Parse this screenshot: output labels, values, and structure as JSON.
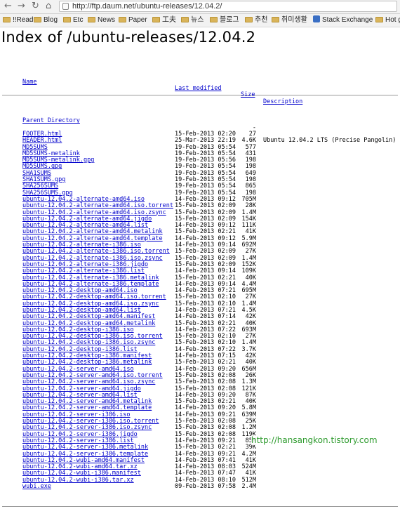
{
  "browser": {
    "back_glyph": "←",
    "forward_glyph": "→",
    "reload_glyph": "↻",
    "home_glyph": "⌂",
    "url": "http://ftp.daum.net/ubuntu-releases/12.04.2/",
    "bookmarks": [
      "!!Read",
      "Blog",
      "Etc",
      "News",
      "Paper",
      "工夫",
      "뉴스",
      "블로그",
      "추천",
      "취미생활",
      "Stack Exchange",
      "Hot gir"
    ]
  },
  "page": {
    "title": "Index of /ubuntu-releases/12.04.2",
    "headers": {
      "name": "Name",
      "modified": "Last modified",
      "size": "Size",
      "description": "Description"
    },
    "parent": {
      "name": "Parent Directory",
      "size": "-"
    },
    "files": [
      {
        "name": "FOOTER.html",
        "date": "15-Feb-2013 02:20",
        "size": "27",
        "desc": ""
      },
      {
        "name": "HEADER.html",
        "date": "25-Mar-2013 22:19",
        "size": "4.6K",
        "desc": "Ubuntu 12.04.2 LTS (Precise Pangolin)"
      },
      {
        "name": "MD5SUMS",
        "date": "19-Feb-2013 05:54",
        "size": "577",
        "desc": ""
      },
      {
        "name": "MD5SUMS-metalink",
        "date": "19-Feb-2013 05:54",
        "size": "431",
        "desc": ""
      },
      {
        "name": "MD5SUMS-metalink.gpg",
        "date": "19-Feb-2013 05:56",
        "size": "198",
        "desc": ""
      },
      {
        "name": "MD5SUMS.gpg",
        "date": "19-Feb-2013 05:54",
        "size": "198",
        "desc": ""
      },
      {
        "name": "SHA1SUMS",
        "date": "19-Feb-2013 05:54",
        "size": "649",
        "desc": ""
      },
      {
        "name": "SHA1SUMS.gpg",
        "date": "19-Feb-2013 05:54",
        "size": "198",
        "desc": ""
      },
      {
        "name": "SHA256SUMS",
        "date": "19-Feb-2013 05:54",
        "size": "865",
        "desc": ""
      },
      {
        "name": "SHA256SUMS.gpg",
        "date": "19-Feb-2013 05:54",
        "size": "198",
        "desc": ""
      },
      {
        "name": "ubuntu-12.04.2-alternate-amd64.iso",
        "date": "14-Feb-2013 09:12",
        "size": "705M",
        "desc": ""
      },
      {
        "name": "ubuntu-12.04.2-alternate-amd64.iso.torrent",
        "date": "15-Feb-2013 02:09",
        "size": "28K",
        "desc": ""
      },
      {
        "name": "ubuntu-12.04.2-alternate-amd64.iso.zsync",
        "date": "15-Feb-2013 02:09",
        "size": "1.4M",
        "desc": ""
      },
      {
        "name": "ubuntu-12.04.2-alternate-amd64.jigdo",
        "date": "15-Feb-2013 02:09",
        "size": "154K",
        "desc": ""
      },
      {
        "name": "ubuntu-12.04.2-alternate-amd64.list",
        "date": "14-Feb-2013 09:12",
        "size": "111K",
        "desc": ""
      },
      {
        "name": "ubuntu-12.04.2-alternate-amd64.metalink",
        "date": "15-Feb-2013 02:21",
        "size": "41K",
        "desc": ""
      },
      {
        "name": "ubuntu-12.04.2-alternate-amd64.template",
        "date": "14-Feb-2013 09:12",
        "size": "5.9M",
        "desc": ""
      },
      {
        "name": "ubuntu-12.04.2-alternate-i386.iso",
        "date": "14-Feb-2013 09:14",
        "size": "692M",
        "desc": ""
      },
      {
        "name": "ubuntu-12.04.2-alternate-i386.iso.torrent",
        "date": "15-Feb-2013 02:09",
        "size": "27K",
        "desc": ""
      },
      {
        "name": "ubuntu-12.04.2-alternate-i386.iso.zsync",
        "date": "15-Feb-2013 02:09",
        "size": "1.4M",
        "desc": ""
      },
      {
        "name": "ubuntu-12.04.2-alternate-i386.jigdo",
        "date": "15-Feb-2013 02:09",
        "size": "152K",
        "desc": ""
      },
      {
        "name": "ubuntu-12.04.2-alternate-i386.list",
        "date": "14-Feb-2013 09:14",
        "size": "109K",
        "desc": ""
      },
      {
        "name": "ubuntu-12.04.2-alternate-i386.metalink",
        "date": "15-Feb-2013 02:21",
        "size": "40K",
        "desc": ""
      },
      {
        "name": "ubuntu-12.04.2-alternate-i386.template",
        "date": "14-Feb-2013 09:14",
        "size": "4.4M",
        "desc": ""
      },
      {
        "name": "ubuntu-12.04.2-desktop-amd64.iso",
        "date": "14-Feb-2013 07:21",
        "size": "695M",
        "desc": ""
      },
      {
        "name": "ubuntu-12.04.2-desktop-amd64.iso.torrent",
        "date": "15-Feb-2013 02:10",
        "size": "27K",
        "desc": ""
      },
      {
        "name": "ubuntu-12.04.2-desktop-amd64.iso.zsync",
        "date": "15-Feb-2013 02:10",
        "size": "1.4M",
        "desc": ""
      },
      {
        "name": "ubuntu-12.04.2-desktop-amd64.list",
        "date": "14-Feb-2013 07:21",
        "size": "4.5K",
        "desc": ""
      },
      {
        "name": "ubuntu-12.04.2-desktop-amd64.manifest",
        "date": "14-Feb-2013 07:14",
        "size": "42K",
        "desc": ""
      },
      {
        "name": "ubuntu-12.04.2-desktop-amd64.metalink",
        "date": "15-Feb-2013 02:21",
        "size": "40K",
        "desc": ""
      },
      {
        "name": "ubuntu-12.04.2-desktop-i386.iso",
        "date": "14-Feb-2013 07:22",
        "size": "693M",
        "desc": ""
      },
      {
        "name": "ubuntu-12.04.2-desktop-i386.iso.torrent",
        "date": "15-Feb-2013 02:10",
        "size": "27K",
        "desc": ""
      },
      {
        "name": "ubuntu-12.04.2-desktop-i386.iso.zsync",
        "date": "15-Feb-2013 02:10",
        "size": "1.4M",
        "desc": ""
      },
      {
        "name": "ubuntu-12.04.2-desktop-i386.list",
        "date": "14-Feb-2013 07:22",
        "size": "3.7K",
        "desc": ""
      },
      {
        "name": "ubuntu-12.04.2-desktop-i386.manifest",
        "date": "14-Feb-2013 07:15",
        "size": "42K",
        "desc": ""
      },
      {
        "name": "ubuntu-12.04.2-desktop-i386.metalink",
        "date": "15-Feb-2013 02:21",
        "size": "40K",
        "desc": ""
      },
      {
        "name": "ubuntu-12.04.2-server-amd64.iso",
        "date": "14-Feb-2013 09:20",
        "size": "656M",
        "desc": ""
      },
      {
        "name": "ubuntu-12.04.2-server-amd64.iso.torrent",
        "date": "15-Feb-2013 02:08",
        "size": "26K",
        "desc": ""
      },
      {
        "name": "ubuntu-12.04.2-server-amd64.iso.zsync",
        "date": "15-Feb-2013 02:08",
        "size": "1.3M",
        "desc": ""
      },
      {
        "name": "ubuntu-12.04.2-server-amd64.jigdo",
        "date": "15-Feb-2013 02:08",
        "size": "121K",
        "desc": ""
      },
      {
        "name": "ubuntu-12.04.2-server-amd64.list",
        "date": "14-Feb-2013 09:20",
        "size": "87K",
        "desc": ""
      },
      {
        "name": "ubuntu-12.04.2-server-amd64.metalink",
        "date": "15-Feb-2013 02:21",
        "size": "40K",
        "desc": ""
      },
      {
        "name": "ubuntu-12.04.2-server-amd64.template",
        "date": "14-Feb-2013 09:20",
        "size": "5.8M",
        "desc": ""
      },
      {
        "name": "ubuntu-12.04.2-server-i386.iso",
        "date": "14-Feb-2013 09:21",
        "size": "639M",
        "desc": ""
      },
      {
        "name": "ubuntu-12.04.2-server-i386.iso.torrent",
        "date": "15-Feb-2013 02:08",
        "size": "25K",
        "desc": ""
      },
      {
        "name": "ubuntu-12.04.2-server-i386.iso.zsync",
        "date": "15-Feb-2013 02:08",
        "size": "1.2M",
        "desc": ""
      },
      {
        "name": "ubuntu-12.04.2-server-i386.jigdo",
        "date": "15-Feb-2013 02:08",
        "size": "119K",
        "desc": ""
      },
      {
        "name": "ubuntu-12.04.2-server-i386.list",
        "date": "14-Feb-2013 09:21",
        "size": "85K",
        "desc": ""
      },
      {
        "name": "ubuntu-12.04.2-server-i386.metalink",
        "date": "15-Feb-2013 02:21",
        "size": "39K",
        "desc": ""
      },
      {
        "name": "ubuntu-12.04.2-server-i386.template",
        "date": "14-Feb-2013 09:21",
        "size": "4.2M",
        "desc": ""
      },
      {
        "name": "ubuntu-12.04.2-wubi-amd64.manifest",
        "date": "14-Feb-2013 07:41",
        "size": "41K",
        "desc": ""
      },
      {
        "name": "ubuntu-12.04.2-wubi-amd64.tar.xz",
        "date": "14-Feb-2013 08:03",
        "size": "524M",
        "desc": ""
      },
      {
        "name": "ubuntu-12.04.2-wubi-i386.manifest",
        "date": "14-Feb-2013 07:47",
        "size": "41K",
        "desc": ""
      },
      {
        "name": "ubuntu-12.04.2-wubi-i386.tar.xz",
        "date": "14-Feb-2013 08:10",
        "size": "512M",
        "desc": ""
      },
      {
        "name": "wubi.exe",
        "date": "09-Feb-2013 07:58",
        "size": "2.4M",
        "desc": ""
      }
    ]
  },
  "watermark": "http://hansangkon.tistory.com",
  "colors": {
    "link": "#0000cc",
    "watermark": "#2e9b2e"
  }
}
